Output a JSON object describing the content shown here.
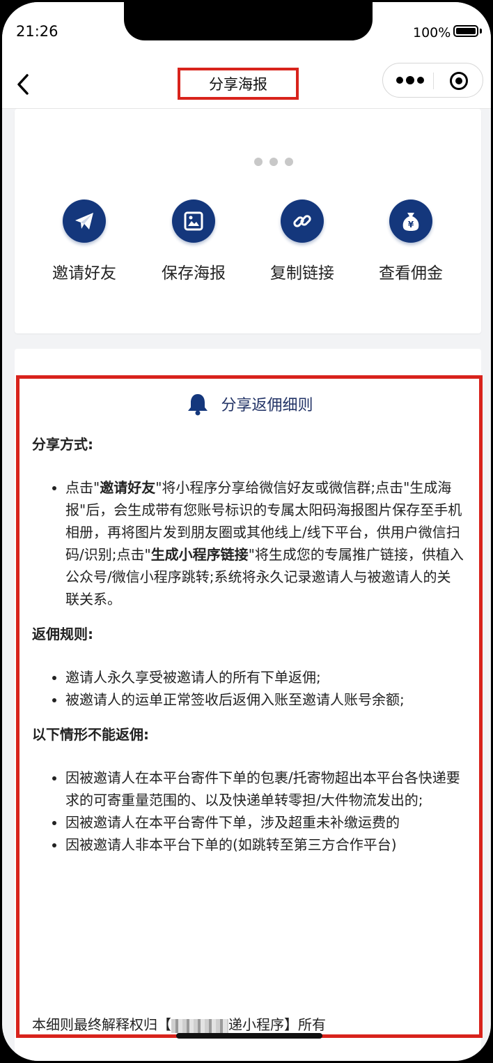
{
  "status_bar": {
    "time": "21:26",
    "battery": "100%"
  },
  "navbar": {
    "title": "分享海报"
  },
  "actions": [
    {
      "label": "邀请好友",
      "icon": "paper-plane-icon"
    },
    {
      "label": "保存海报",
      "icon": "image-icon"
    },
    {
      "label": "复制链接",
      "icon": "link-icon"
    },
    {
      "label": "查看佣金",
      "icon": "money-bag-icon"
    }
  ],
  "rules": {
    "heading": "分享返佣细则",
    "section1_title": "分享方式:",
    "section1_items": [
      {
        "p1": "点击\"",
        "b1": "邀请好友",
        "p2": "\"将小程序分享给微信好友或微信群;点击\"生成海报\"后，会生成带有您账号标识的专属太阳码海报图片保存至手机相册，再将图片发到朋友圈或其他线上/线下平台，供用户微信扫码/识别;点击\"",
        "b2": "生成小程序链接",
        "p3": "\"将生成您的专属推广链接，供植入公众号/微信小程序跳转;系统将永久记录邀请人与被邀请人的关联关系。"
      }
    ],
    "section2_title": "返佣规则:",
    "section2_items": [
      "邀请人永久享受被邀请人的所有下单返佣;",
      "被邀请人的运单正常签收后返佣入账至邀请人账号余额;"
    ],
    "section3_title": "以下情形不能返佣:",
    "section3_items": [
      "因被邀请人在本平台寄件下单的包裹/托寄物超出本平台各快递要求的可寄重量范围的、以及快递单转零担/大件物流发出的;",
      "因被邀请人在本平台寄件下单，涉及超重未补缴运费的",
      "因被邀请人非本平台下单的(如跳转至第三方合作平台)"
    ],
    "footer_prefix": "本细则最终解释权归【",
    "footer_suffix": "递小程序】所有"
  },
  "colors": {
    "primary": "#14377c",
    "highlight": "#d8231c"
  }
}
